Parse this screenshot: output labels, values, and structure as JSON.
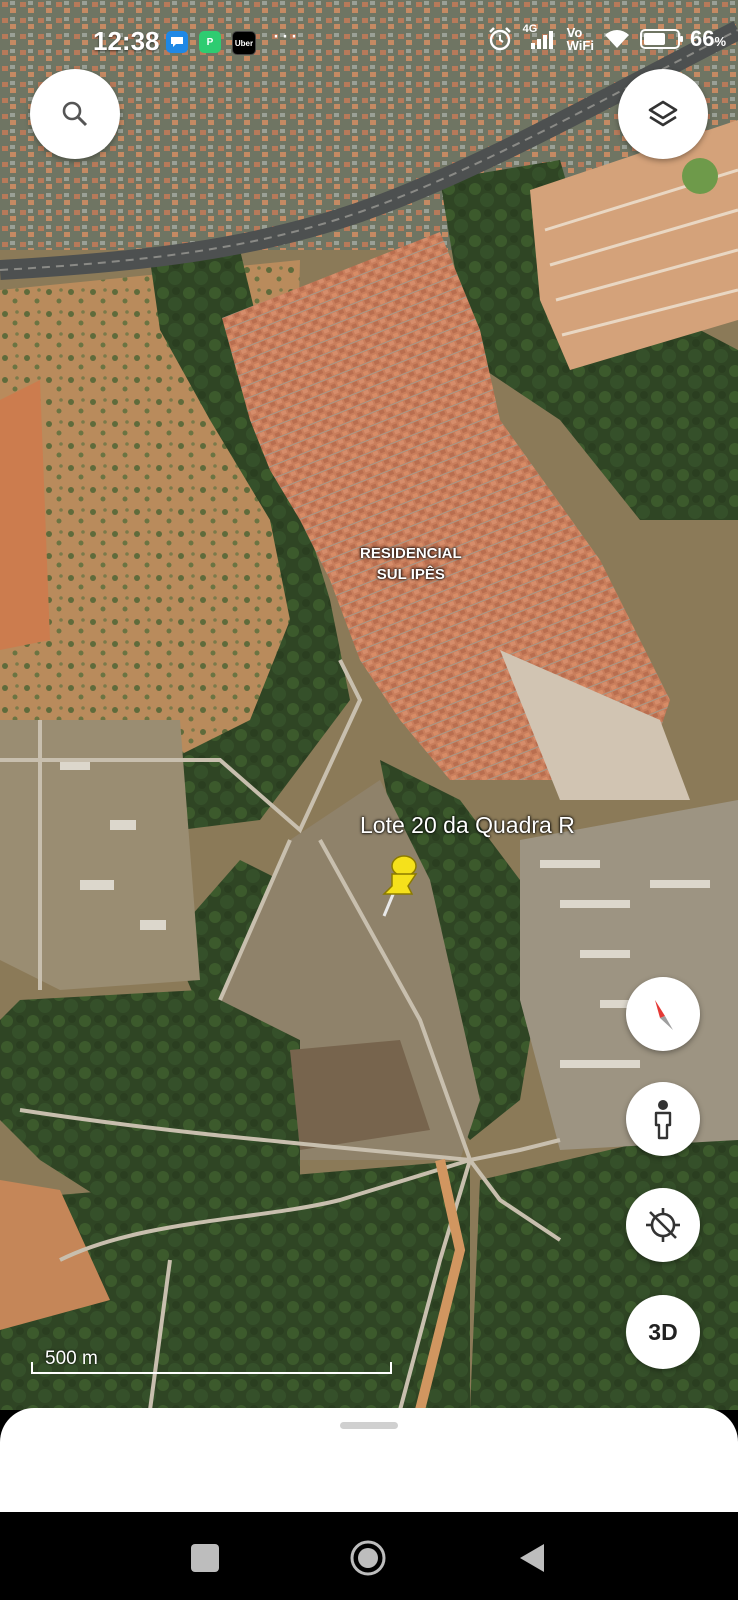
{
  "status_bar": {
    "time": "12:38",
    "app_icons": [
      {
        "name": "message-icon",
        "color": "#1e88e5",
        "glyph": "●"
      },
      {
        "name": "p-app-icon",
        "color": "#2ecc71",
        "glyph": "P"
      },
      {
        "name": "uber-icon",
        "color": "#000000",
        "glyph": "Uber"
      }
    ],
    "overflow": "···",
    "network": "4G",
    "vowifi_top": "Vo",
    "vowifi_bottom": "WiFi",
    "battery_level": 0.66,
    "battery_percent": "66"
  },
  "map": {
    "place_label_line1": "RESIDENCIAL",
    "place_label_line2": "SUL IPÊS",
    "pin_label": "Lote 20 da Quadra R",
    "pin_color": "#f5e11b",
    "scale_text": "500 m"
  },
  "controls": {
    "search_icon": "search-icon",
    "layers_icon": "layers-icon",
    "compass_icon": "compass-icon",
    "street_view_icon": "pegman-icon",
    "location_icon": "location-off-icon",
    "three_d": "3D"
  },
  "nav": {
    "recents_icon": "square-icon",
    "home_icon": "circle-icon",
    "back_icon": "triangle-back-icon"
  }
}
